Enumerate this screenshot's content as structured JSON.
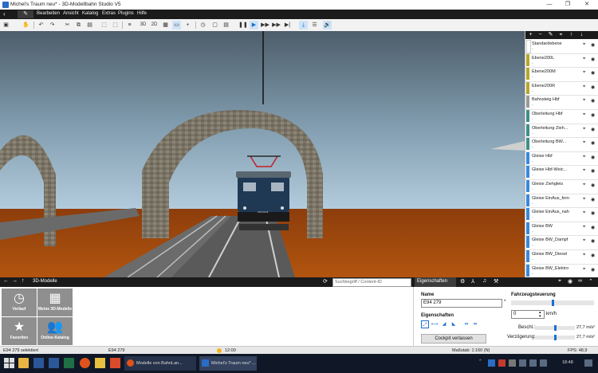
{
  "window": {
    "title": "Michel's Traum neu* - 3D-Modellbahn Studio V5",
    "min": "—",
    "max": "❐",
    "close": "✕"
  },
  "menu": {
    "items": [
      "Bearbeiten",
      "Ansicht",
      "Katalog",
      "Extras",
      "Plugins",
      "Hilfe"
    ]
  },
  "toolbar": {
    "btn_2d": "2D",
    "btn_3d": "3D"
  },
  "viewport": {
    "locomotive_number": "118 044-8"
  },
  "layers": [
    {
      "name": "Standardebene",
      "desc": "-",
      "color": "#ffffff"
    },
    {
      "name": "Ebene200L",
      "desc": "-",
      "color": "#b5a62a"
    },
    {
      "name": "Ebene200M",
      "desc": "-",
      "color": "#b5a62a"
    },
    {
      "name": "Ebene200R",
      "desc": "-",
      "color": "#b5a62a"
    },
    {
      "name": "Bahnsteig Hbf",
      "desc": "-",
      "color": "#999999"
    },
    {
      "name": "Oberleitung Hbf",
      "desc": "-",
      "color": "#3f8f88"
    },
    {
      "name": "Oberleitung Zieh...",
      "desc": "-",
      "color": "#3f8f88"
    },
    {
      "name": "Oberleitung BW...",
      "desc": "-",
      "color": "#3f8f88"
    },
    {
      "name": "Gleise Hbf",
      "desc": "-",
      "color": "#3a88d8"
    },
    {
      "name": "Gleise Hbf-Weic...",
      "desc": "-",
      "color": "#3a88d8"
    },
    {
      "name": "Gleise Ziehgleis",
      "desc": "-",
      "color": "#3a88d8"
    },
    {
      "name": "Gleise EinAus_fern",
      "desc": "-",
      "color": "#3a88d8"
    },
    {
      "name": "Gleise EinAus_nah",
      "desc": "-",
      "color": "#3a88d8"
    },
    {
      "name": "Gleise BW",
      "desc": "-",
      "color": "#3a88d8"
    },
    {
      "name": "Gleise BW_Dampf",
      "desc": "-",
      "color": "#3a88d8"
    },
    {
      "name": "Gleise BW_Diesel",
      "desc": "-",
      "color": "#3a88d8"
    },
    {
      "name": "Gleise BW_Elektro",
      "desc": "-",
      "color": "#3a88d8"
    }
  ],
  "models_panel": {
    "title": "3D-Modelle",
    "search_placeholder": "Suchbegriff / Content-ID",
    "tiles": [
      {
        "label": "Verlauf",
        "icon": "clock-icon"
      },
      {
        "label": "Meine 3D-Modelle",
        "icon": "grid-icon"
      },
      {
        "label": "Favoriten",
        "icon": "star-icon"
      },
      {
        "label": "Online-Katalog",
        "icon": "people-icon"
      }
    ]
  },
  "properties": {
    "title": "Eigenschaften",
    "name_label": "Name",
    "name_value": "E94 279",
    "required_mark": "*",
    "eig_label": "Eigenschaften",
    "cockpit_button": "Cockpit verlassen",
    "control_title": "Fahrzeugsteuerung",
    "speed_value": "0",
    "speed_unit": "km/h",
    "speed_level": 0.5,
    "accel_label": "Beschl.:",
    "accel_value": "27,7 m/s²",
    "decel_label": "Verzögerung:",
    "decel_value": "27,7 m/s²"
  },
  "status": {
    "selection": "E94 279 selektiert",
    "object": "E94 279",
    "time": "12:00",
    "scale": "Maßstab: 1:160 (N)",
    "fps": "FPS: 48,9"
  },
  "taskbar": {
    "task1": "Modelle von BahnLan...",
    "task2": "Michel's Traum neu* ...",
    "clock": "18:48"
  }
}
